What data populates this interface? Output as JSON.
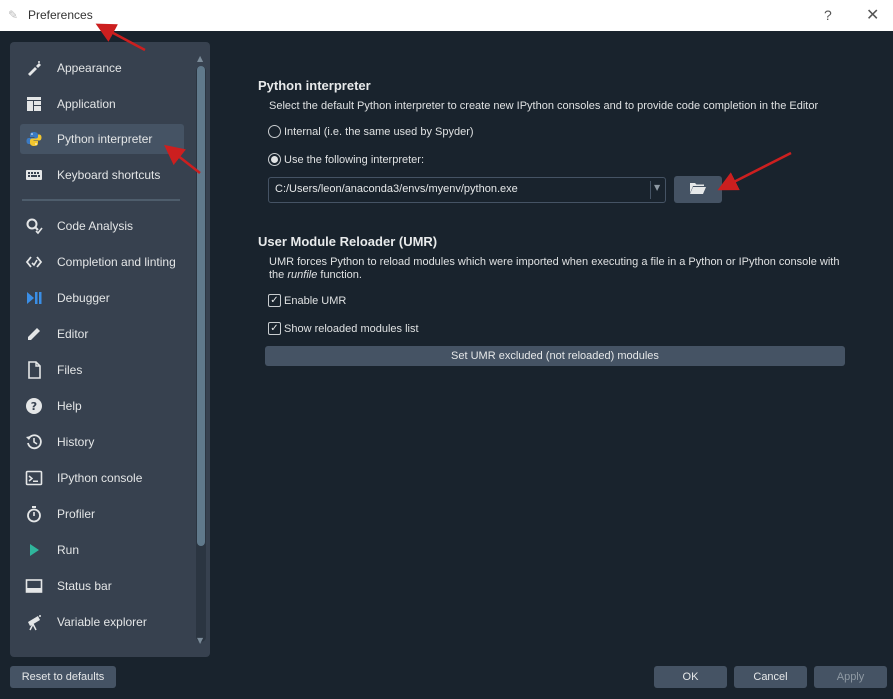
{
  "window": {
    "title": "Preferences",
    "help_glyph": "?",
    "close_glyph": "✕"
  },
  "sidebar": {
    "items": [
      {
        "label": "Appearance",
        "icon": "paintbrush-icon"
      },
      {
        "label": "Application",
        "icon": "application-layout-icon"
      },
      {
        "label": "Python interpreter",
        "icon": "python-logo-icon",
        "selected": true
      },
      {
        "label": "Keyboard shortcuts",
        "icon": "keyboard-icon"
      },
      {
        "label": "Code Analysis",
        "icon": "code-analysis-icon"
      },
      {
        "label": "Completion and linting",
        "icon": "code-brackets-icon"
      },
      {
        "label": "Debugger",
        "icon": "debugger-icon"
      },
      {
        "label": "Editor",
        "icon": "pencil-icon"
      },
      {
        "label": "Files",
        "icon": "file-icon"
      },
      {
        "label": "Help",
        "icon": "help-circle-icon"
      },
      {
        "label": "History",
        "icon": "history-icon"
      },
      {
        "label": "IPython console",
        "icon": "terminal-icon"
      },
      {
        "label": "Profiler",
        "icon": "stopwatch-icon"
      },
      {
        "label": "Run",
        "icon": "play-icon"
      },
      {
        "label": "Status bar",
        "icon": "status-bar-icon"
      },
      {
        "label": "Variable explorer",
        "icon": "telescope-icon"
      }
    ]
  },
  "python_interpreter": {
    "heading": "Python interpreter",
    "description": "Select the default Python interpreter to create new IPython consoles and to provide code completion in the Editor",
    "option_internal": "Internal (i.e. the same used by Spyder)",
    "option_custom": "Use the following interpreter:",
    "selected_option": "custom",
    "interpreter_path": "C:/Users/leon/anaconda3/envs/myenv/python.exe"
  },
  "umr": {
    "heading": "User Module Reloader (UMR)",
    "description_part1": "UMR forces Python to reload modules which were imported when executing a file in a Python or IPython console with",
    "description_part2_prefix": "the ",
    "description_part2_italic": "runfile",
    "description_part2_suffix": " function.",
    "enable_label": "Enable UMR",
    "enable_checked": true,
    "show_list_label": "Show reloaded modules list",
    "show_list_checked": true,
    "excluded_button": "Set UMR excluded (not reloaded) modules"
  },
  "footer": {
    "reset_label": "Reset to defaults",
    "ok_label": "OK",
    "cancel_label": "Cancel",
    "apply_label": "Apply"
  },
  "colors": {
    "background": "#19232d",
    "sidebar": "#37414f",
    "button": "#455364",
    "annotation_arrow": "#cc1f1f",
    "accent_run": "#2fb59c",
    "accent_debugger": "#3a8ee6"
  }
}
